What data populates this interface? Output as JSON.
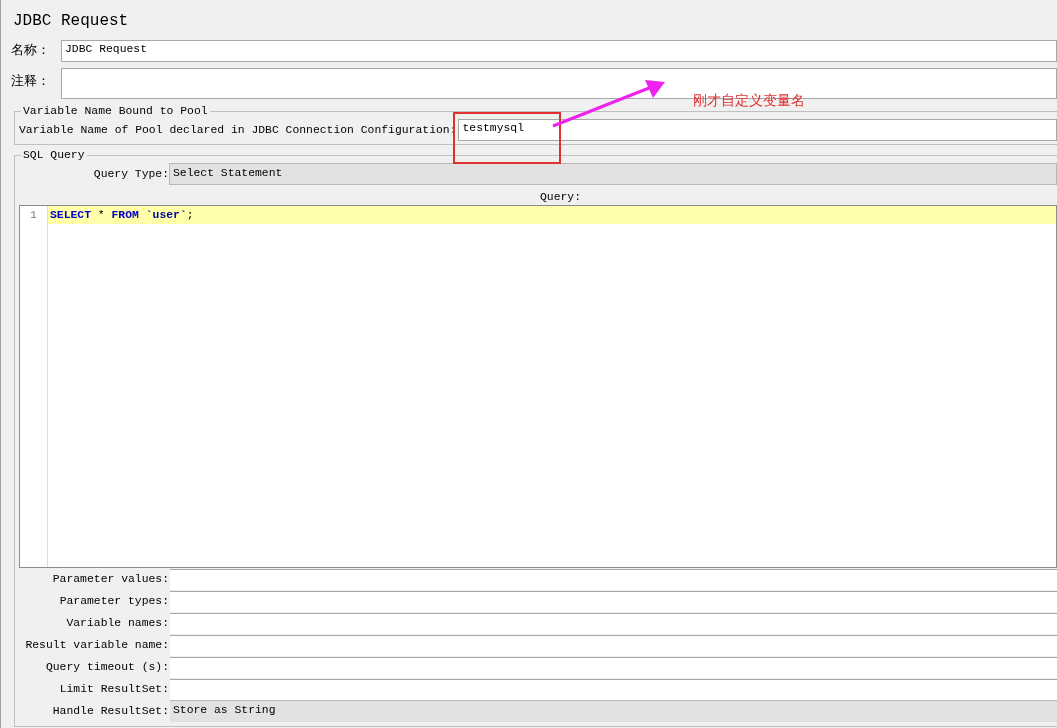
{
  "window": {
    "title": "JDBC Request"
  },
  "name_field": {
    "label": "名称：",
    "value": "JDBC Request"
  },
  "comment_field": {
    "label": "注释："
  },
  "pool_section": {
    "legend": "Variable Name Bound to Pool",
    "label": "Variable Name of Pool declared in JDBC Connection Configuration:",
    "value": "testmysql"
  },
  "sql_section": {
    "legend": "SQL Query",
    "query_type": {
      "label": "Query Type:",
      "value": "Select Statement"
    },
    "query_label": "Query:",
    "editor": {
      "lines": [
        {
          "number": "1",
          "highlighted": true,
          "tokens": [
            {
              "kind": "keyword",
              "text": "SELECT"
            },
            {
              "kind": "plain",
              "text": " * "
            },
            {
              "kind": "keyword",
              "text": "FROM"
            },
            {
              "kind": "identifier",
              "text": " `user`"
            },
            {
              "kind": "plain",
              "text": ";"
            }
          ]
        }
      ]
    },
    "fields": [
      {
        "kind": "text",
        "label": "Parameter values:"
      },
      {
        "kind": "text",
        "label": "Parameter types:"
      },
      {
        "kind": "text",
        "label": "Variable names:"
      },
      {
        "kind": "text",
        "label": "Result variable name:"
      },
      {
        "kind": "text",
        "label": "Query timeout (s):"
      },
      {
        "kind": "text",
        "label": "Limit ResultSet:"
      },
      {
        "kind": "combo",
        "label": "Handle ResultSet:",
        "value": "Store as String"
      }
    ]
  },
  "annotation": {
    "text": "刚才自定义变量名"
  }
}
